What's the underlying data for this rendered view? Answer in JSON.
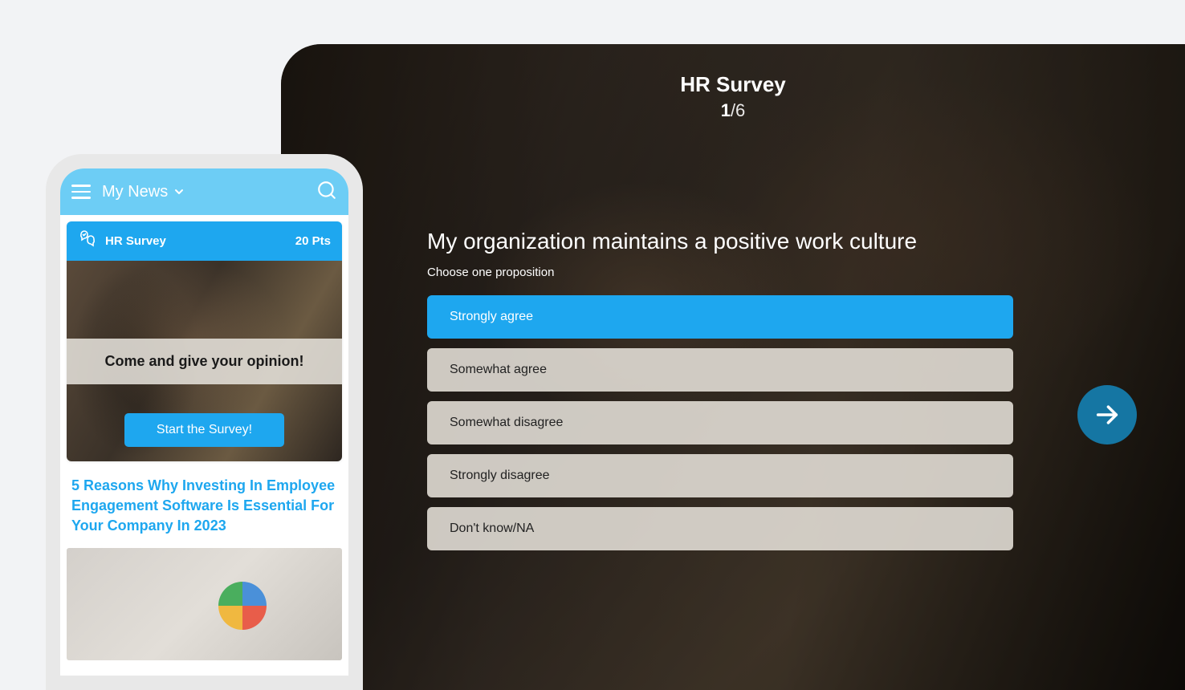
{
  "tablet": {
    "survey": {
      "title": "HR Survey",
      "progress": {
        "current": "1",
        "total": "/6"
      },
      "question": "My organization maintains a positive work culture",
      "hint": "Choose one proposition",
      "options": [
        {
          "label": "Strongly agree",
          "selected": true
        },
        {
          "label": "Somewhat agree",
          "selected": false
        },
        {
          "label": "Somewhat disagree",
          "selected": false
        },
        {
          "label": "Strongly disagree",
          "selected": false
        },
        {
          "label": "Don't know/NA",
          "selected": false
        }
      ]
    }
  },
  "phone": {
    "topbar": {
      "title": "My News"
    },
    "card": {
      "title": "HR Survey",
      "points": "20 Pts",
      "banner": "Come and give your opinion!",
      "cta": "Start the Survey!"
    },
    "news": {
      "title": "5 Reasons Why Investing In Employee Engagement Software Is Essential For Your Company In 2023"
    }
  }
}
